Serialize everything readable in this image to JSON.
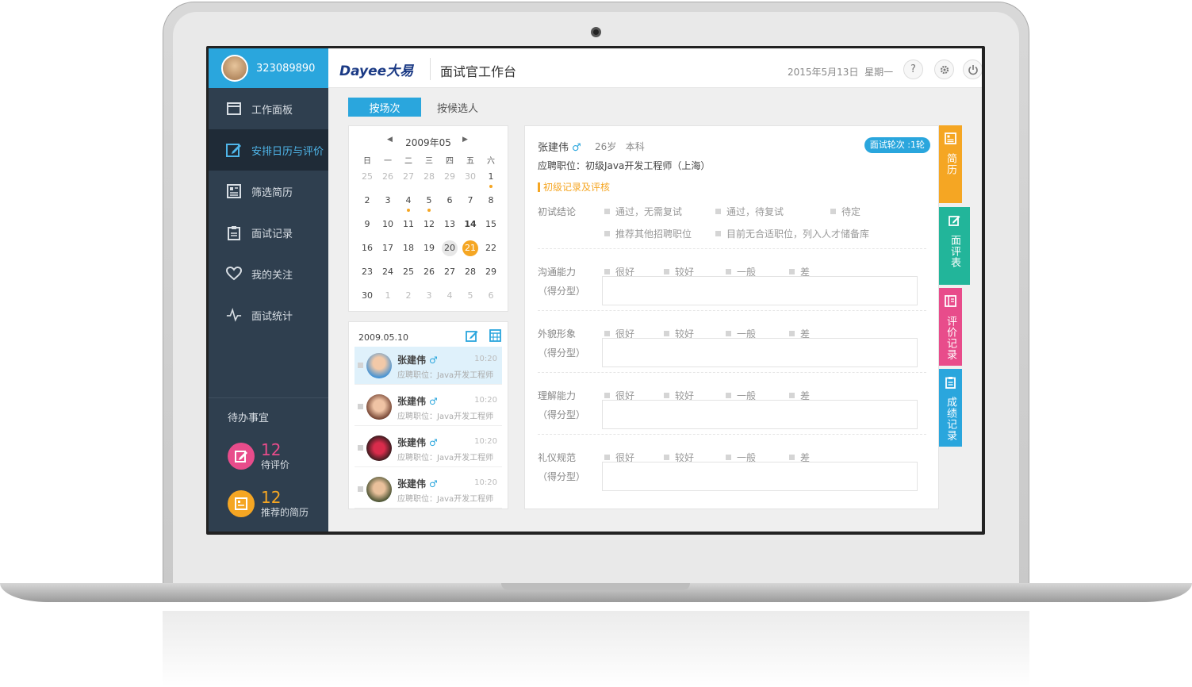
{
  "user": {
    "id": "323089890"
  },
  "sidebar": {
    "items": [
      {
        "label": "工作面板",
        "icon": "window-icon"
      },
      {
        "label": "安排日历与评价",
        "icon": "edit-icon",
        "active": true
      },
      {
        "label": "筛选简历",
        "icon": "resume-icon"
      },
      {
        "label": "面试记录",
        "icon": "clipboard-icon"
      },
      {
        "label": "我的关注",
        "icon": "heart-icon"
      },
      {
        "label": "面试统计",
        "icon": "pulse-icon"
      }
    ],
    "todo": {
      "title": "待办事宜",
      "items": [
        {
          "count": "12",
          "label": "待评价",
          "color": "#e84c8b"
        },
        {
          "count": "12",
          "label": "推荐的简历",
          "color": "#f5a623"
        }
      ]
    }
  },
  "header": {
    "logo": "Dayee大易",
    "title": "面试官工作台",
    "date": "2015年5月13日",
    "weekday": "星期一",
    "help": "?"
  },
  "tabs": [
    {
      "label": "按场次",
      "active": true
    },
    {
      "label": "按候选人",
      "active": false
    }
  ],
  "calendar": {
    "month": "2009年05",
    "weekdays": [
      "日",
      "一",
      "二",
      "三",
      "四",
      "五",
      "六"
    ],
    "weeks": [
      [
        "25",
        "26",
        "27",
        "28",
        "29",
        "30",
        "1"
      ],
      [
        "2",
        "3",
        "4",
        "5",
        "6",
        "7",
        "8"
      ],
      [
        "9",
        "10",
        "11",
        "12",
        "13",
        "14",
        "15"
      ],
      [
        "16",
        "17",
        "18",
        "19",
        "20",
        "21",
        "22"
      ],
      [
        "23",
        "24",
        "25",
        "26",
        "27",
        "28",
        "29"
      ],
      [
        "30",
        "1",
        "2",
        "3",
        "4",
        "5",
        "6"
      ]
    ],
    "selected": "21",
    "hovered": "20",
    "bold": "14"
  },
  "schedule": {
    "date": "2009.05.10",
    "candidates": [
      {
        "name": "张建伟",
        "gender": "♂",
        "time": "10:20",
        "position": "应聘职位：Java开发工程师",
        "active": true
      },
      {
        "name": "张建伟",
        "gender": "♂",
        "time": "10:20",
        "position": "应聘职位：Java开发工程师"
      },
      {
        "name": "张建伟",
        "gender": "♂",
        "time": "10:20",
        "position": "应聘职位：Java开发工程师"
      },
      {
        "name": "张建伟",
        "gender": "♂",
        "time": "10:20",
        "position": "应聘职位：Java开发工程师"
      }
    ]
  },
  "detail": {
    "name": "张建伟",
    "gender": "♂",
    "age": "26岁",
    "education": "本科",
    "round": "面试轮次 :1轮",
    "position": "应聘职位：初级Java开发工程师（上海）",
    "section": "初级记录及评核",
    "conclusion": {
      "label": "初试结论",
      "options": [
        "通过，无需复试",
        "通过，待复试",
        "待定",
        "推荐其他招聘职位",
        "目前无合适职位，列入人才储备库"
      ]
    },
    "score_type": "（得分型）",
    "criteria": [
      {
        "label": "沟通能力"
      },
      {
        "label": "外貌形象"
      },
      {
        "label": "理解能力"
      },
      {
        "label": "礼仪规范"
      }
    ],
    "levels": [
      "很好",
      "较好",
      "一般",
      "差"
    ]
  },
  "side_tabs": [
    {
      "label": "简历",
      "color": "#f5a623"
    },
    {
      "label": "面评表",
      "color": "#22b59a"
    },
    {
      "label": "评价记录",
      "color": "#e84c8b"
    },
    {
      "label": "成绩记录",
      "color": "#2aa6dd"
    }
  ]
}
